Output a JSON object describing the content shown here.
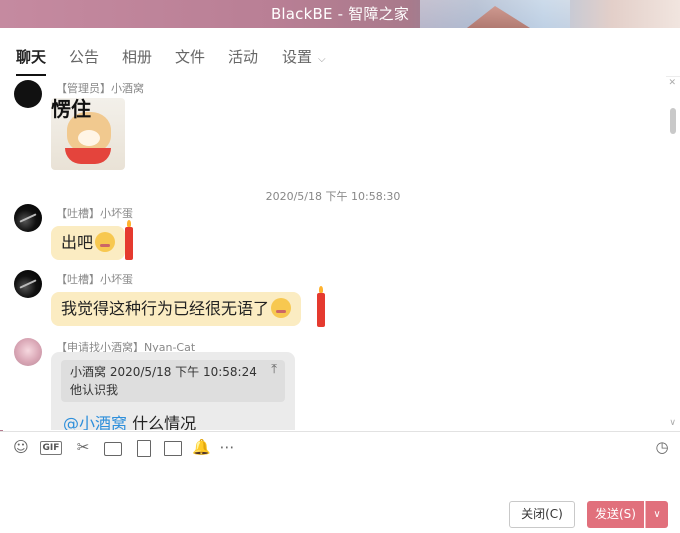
{
  "window": {
    "title": "BlackBE - 智障之家"
  },
  "tabs": [
    {
      "label": "聊天",
      "active": true
    },
    {
      "label": "公告"
    },
    {
      "label": "相册"
    },
    {
      "label": "文件"
    },
    {
      "label": "活动"
    },
    {
      "label": "设置"
    }
  ],
  "messages": [
    {
      "sender": "【管理员】小酒窝",
      "type": "image",
      "image_caption": "愣住"
    },
    {
      "timestamp": "2020/5/18 下午 10:58:30"
    },
    {
      "sender": "【吐槽】小坏蛋",
      "text": "出吧"
    },
    {
      "sender": "【吐槽】小坏蛋",
      "text": "我觉得这种行为已经很无语了"
    },
    {
      "sender": "【申请找小酒窝】Nyan-Cat",
      "quote": {
        "author_time": "小酒窝  2020/5/18 下午 10:58:24",
        "text": "他认识我"
      },
      "mention": "@小酒窝",
      "text": "什么情况"
    }
  ],
  "toolbar": {
    "icons": [
      "emoji-icon",
      "gif-icon",
      "scissors-icon",
      "folder-icon",
      "file-icon",
      "image-icon",
      "bell-icon",
      "more-icon",
      "history-icon"
    ],
    "gif_label": "GIF"
  },
  "buttons": {
    "close_label": "关闭(C)",
    "send_label": "发送(S)"
  },
  "colors": {
    "bubble": "#fbecc2",
    "send_button": "#e1707c",
    "mention": "#2e8fdb",
    "titlebar": "#b97f95"
  }
}
